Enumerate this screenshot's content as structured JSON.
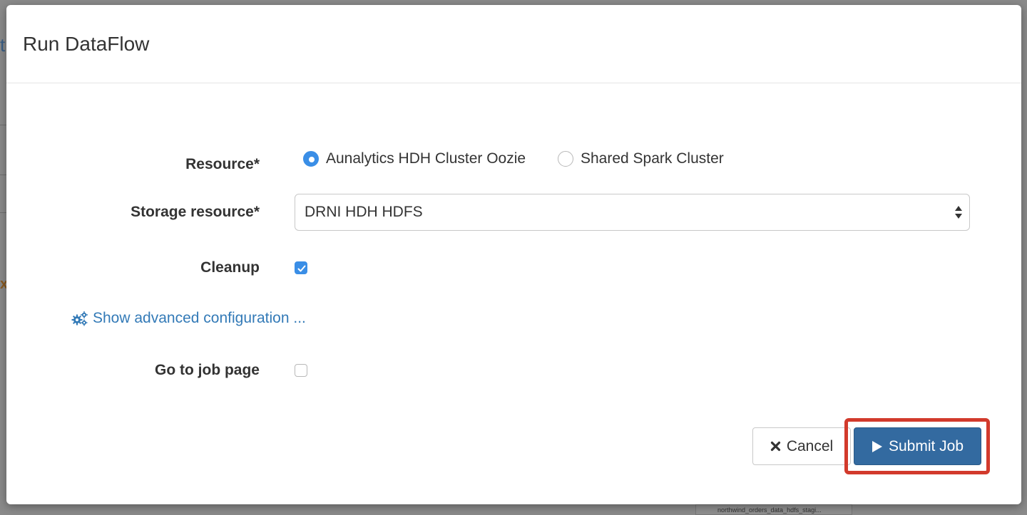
{
  "background": {
    "edge_letter": "t",
    "edge_x": "x",
    "bottom_box_text": "northwind_orders_data_hdfs_stagi..."
  },
  "modal": {
    "title": "Run DataFlow",
    "resource": {
      "label": "Resource*",
      "options": [
        {
          "label": "Aunalytics HDH Cluster Oozie",
          "checked": true
        },
        {
          "label": "Shared Spark Cluster",
          "checked": false
        }
      ]
    },
    "storage_resource": {
      "label": "Storage resource*",
      "value": "DRNI HDH HDFS"
    },
    "cleanup": {
      "label": "Cleanup",
      "checked": true
    },
    "advanced_link": "Show advanced configuration ...",
    "go_to_job_page": {
      "label": "Go to job page",
      "checked": false
    },
    "buttons": {
      "cancel": "Cancel",
      "submit": "Submit Job"
    }
  },
  "colors": {
    "primary": "#336aa0",
    "accent": "#3a8ee6",
    "link": "#337ab7",
    "highlight": "#d23a2c"
  },
  "icons": {
    "cancel": "times-icon",
    "submit": "play-icon",
    "advanced": "cogs-icon"
  }
}
